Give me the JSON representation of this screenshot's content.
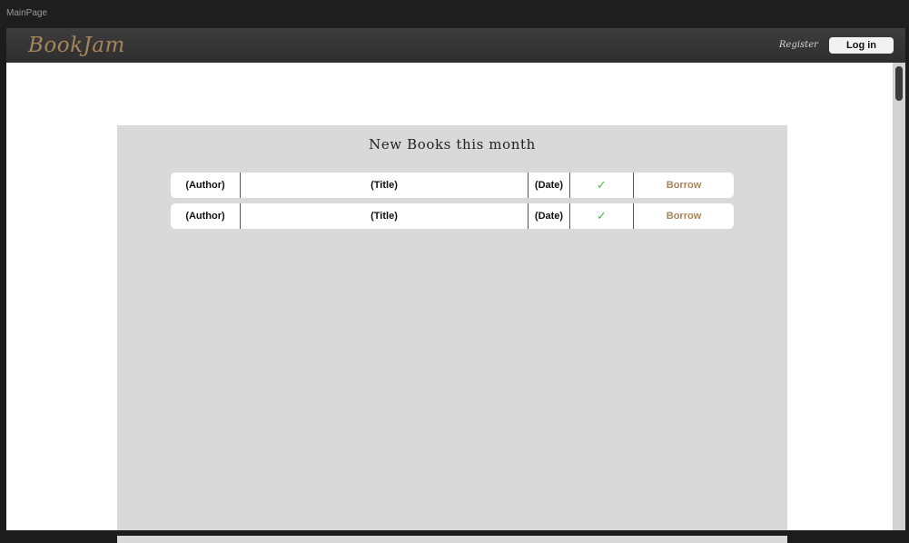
{
  "window": {
    "title": "MainPage"
  },
  "header": {
    "logo": "BookJam",
    "register_label": "Register",
    "login_label": "Log in"
  },
  "main": {
    "section_title": "New Books this month",
    "books": [
      {
        "author": "(Author)",
        "title": "(Title)",
        "date": "(Date)",
        "available": "✓",
        "action": "Borrow"
      },
      {
        "author": "(Author)",
        "title": "(Title)",
        "date": "(Date)",
        "available": "✓",
        "action": "Borrow"
      }
    ]
  },
  "colors": {
    "brand": "#a8845a",
    "check": "#3cc43c",
    "panel": "#d9d9d9",
    "appbar": "#363636"
  },
  "icons": {
    "availability": "check-icon"
  }
}
